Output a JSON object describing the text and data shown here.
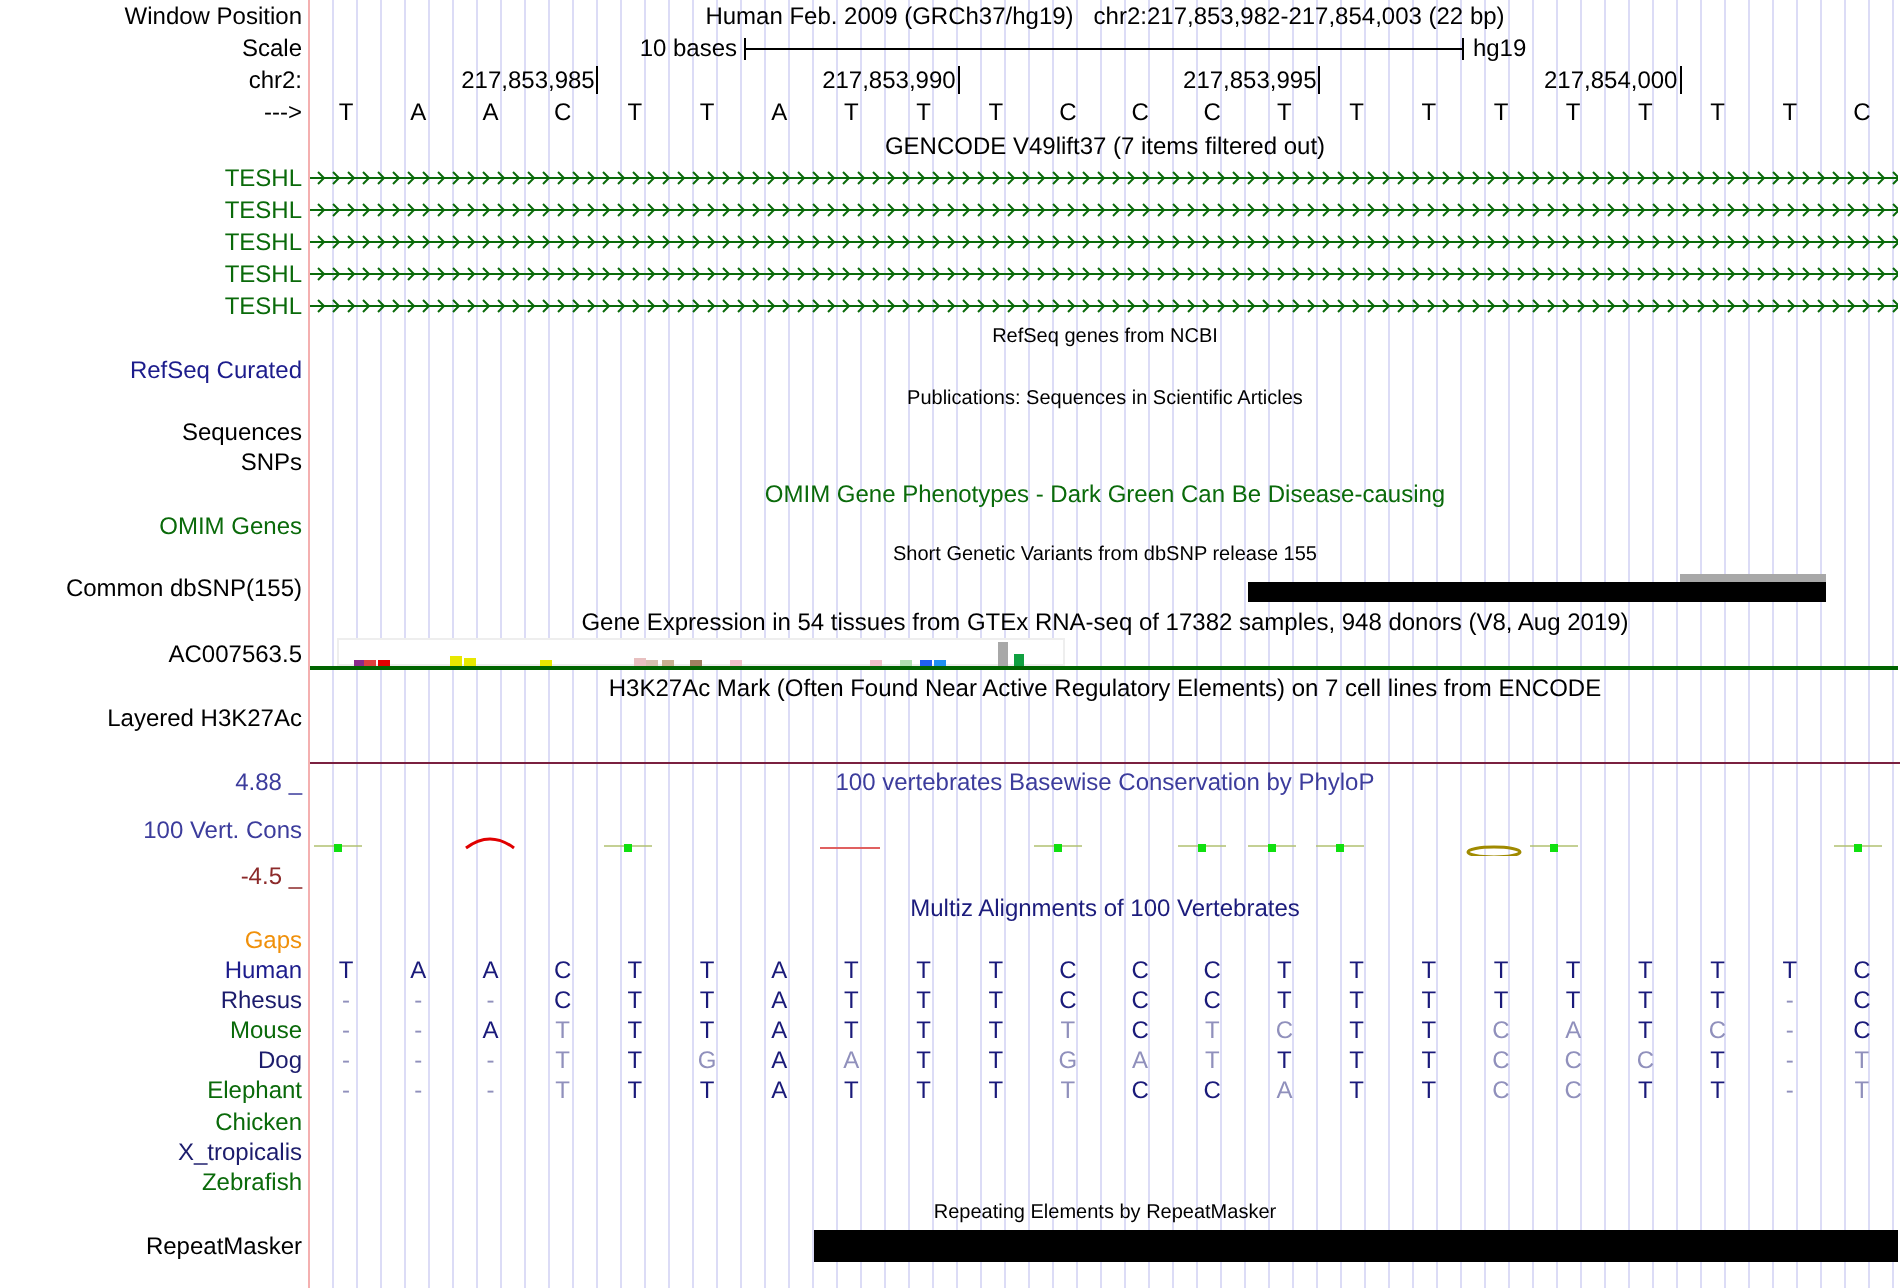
{
  "header": {
    "window_position_label": "Window Position",
    "position_title": "Human Feb. 2009 (GRCh37/hg19)   chr2:217,853,982-217,854,003 (22 bp)",
    "scale_label": "Scale",
    "scale_text": "10 bases",
    "assembly": "hg19",
    "chrom_label": "chr2:",
    "ticks": [
      "217,853,985",
      "217,853,990",
      "217,853,995",
      "217,854,000"
    ],
    "strand_label": "--->",
    "bases": [
      "T",
      "A",
      "A",
      "C",
      "T",
      "T",
      "A",
      "T",
      "T",
      "T",
      "C",
      "C",
      "C",
      "T",
      "T",
      "T",
      "T",
      "T",
      "T",
      "T",
      "T",
      "C"
    ]
  },
  "tracks": [
    {
      "kind": "title",
      "text": "GENCODE V49lift37 (7 items filtered out)",
      "color": "#000000"
    },
    {
      "kind": "gene",
      "label": "TESHL",
      "color": "#0a6a0a"
    },
    {
      "kind": "gene",
      "label": "TESHL",
      "color": "#0a6a0a"
    },
    {
      "kind": "gene",
      "label": "TESHL",
      "color": "#0a6a0a"
    },
    {
      "kind": "gene",
      "label": "TESHL",
      "color": "#0a6a0a"
    },
    {
      "kind": "gene",
      "label": "TESHL",
      "color": "#0a6a0a"
    },
    {
      "kind": "caption",
      "text": "RefSeq genes from NCBI",
      "color": "#000000"
    },
    {
      "kind": "label",
      "label": "RefSeq Curated",
      "color": "#1c1c8c"
    },
    {
      "kind": "caption",
      "text": "Publications: Sequences in Scientific Articles",
      "color": "#000000"
    },
    {
      "kind": "label",
      "label": "Sequences",
      "color": "#000000"
    },
    {
      "kind": "label",
      "label": "SNPs",
      "color": "#000000"
    },
    {
      "kind": "title",
      "text": "OMIM Gene Phenotypes - Dark Green Can Be Disease-causing",
      "color": "#0a6a0a"
    },
    {
      "kind": "label",
      "label": "OMIM Genes",
      "color": "#0a6a0a"
    },
    {
      "kind": "caption",
      "text": "Short Genetic Variants from dbSNP release 155",
      "color": "#000000"
    },
    {
      "kind": "snp",
      "label": "Common dbSNP(155)",
      "color": "#000000"
    },
    {
      "kind": "title",
      "text": "Gene Expression in 54 tissues from GTEx RNA-seq of 17382 samples, 948 donors (V8, Aug 2019)",
      "color": "#000000"
    },
    {
      "kind": "expression",
      "label": "AC007563.5",
      "color": "#000000"
    },
    {
      "kind": "title",
      "text": "H3K27Ac Mark (Often Found Near Active Regulatory Elements) on 7 cell lines from ENCODE",
      "color": "#000000"
    },
    {
      "kind": "signal",
      "label": "Layered H3K27Ac",
      "color": "#000000"
    },
    {
      "kind": "title",
      "label": "4.88 _",
      "text": "100 vertebrates Basewise Conservation by PhyloP",
      "color": "#3c3c9c"
    },
    {
      "kind": "conservation",
      "label": "100 Vert. Cons",
      "color": "#3c3c9c"
    },
    {
      "kind": "label",
      "label": "-4.5 _",
      "color": "#8c2a2a"
    },
    {
      "kind": "title",
      "text": "Multiz Alignments of 100 Vertebrates",
      "color": "#1c1c7c"
    },
    {
      "kind": "label",
      "label": "Gaps",
      "color": "#f0900a"
    },
    {
      "kind": "alignment",
      "label": "Human",
      "color": "#1c1c8c",
      "bases": [
        {
          "b": "T",
          "differs": false
        },
        {
          "b": "A",
          "differs": false
        },
        {
          "b": "A",
          "differs": false
        },
        {
          "b": "C",
          "differs": false
        },
        {
          "b": "T",
          "differs": false
        },
        {
          "b": "T",
          "differs": false
        },
        {
          "b": "A",
          "differs": false
        },
        {
          "b": "T",
          "differs": false
        },
        {
          "b": "T",
          "differs": false
        },
        {
          "b": "T",
          "differs": false
        },
        {
          "b": "C",
          "differs": false
        },
        {
          "b": "C",
          "differs": false
        },
        {
          "b": "C",
          "differs": false
        },
        {
          "b": "T",
          "differs": false
        },
        {
          "b": "T",
          "differs": false
        },
        {
          "b": "T",
          "differs": false
        },
        {
          "b": "T",
          "differs": false
        },
        {
          "b": "T",
          "differs": false
        },
        {
          "b": "T",
          "differs": false
        },
        {
          "b": "T",
          "differs": false
        },
        {
          "b": "T",
          "differs": false
        },
        {
          "b": "C",
          "differs": false
        }
      ]
    },
    {
      "kind": "alignment",
      "label": "Rhesus",
      "color": "#1c1c6c",
      "bases": [
        {
          "b": "-",
          "differs": true
        },
        {
          "b": "-",
          "differs": true
        },
        {
          "b": "-",
          "differs": true
        },
        {
          "b": "C",
          "differs": false
        },
        {
          "b": "T",
          "differs": false
        },
        {
          "b": "T",
          "differs": false
        },
        {
          "b": "A",
          "differs": false
        },
        {
          "b": "T",
          "differs": false
        },
        {
          "b": "T",
          "differs": false
        },
        {
          "b": "T",
          "differs": false
        },
        {
          "b": "C",
          "differs": false
        },
        {
          "b": "C",
          "differs": false
        },
        {
          "b": "C",
          "differs": false
        },
        {
          "b": "T",
          "differs": false
        },
        {
          "b": "T",
          "differs": false
        },
        {
          "b": "T",
          "differs": false
        },
        {
          "b": "T",
          "differs": false
        },
        {
          "b": "T",
          "differs": false
        },
        {
          "b": "T",
          "differs": false
        },
        {
          "b": "T",
          "differs": false
        },
        {
          "b": "-",
          "differs": true
        },
        {
          "b": "C",
          "differs": false
        }
      ]
    },
    {
      "kind": "alignment",
      "label": "Mouse",
      "color": "#0a6a0a",
      "bases": [
        {
          "b": "-",
          "differs": true
        },
        {
          "b": "-",
          "differs": true
        },
        {
          "b": "A",
          "differs": false
        },
        {
          "b": "T",
          "differs": true
        },
        {
          "b": "T",
          "differs": false
        },
        {
          "b": "T",
          "differs": false
        },
        {
          "b": "A",
          "differs": false
        },
        {
          "b": "T",
          "differs": false
        },
        {
          "b": "T",
          "differs": false
        },
        {
          "b": "T",
          "differs": false
        },
        {
          "b": "T",
          "differs": true
        },
        {
          "b": "C",
          "differs": false
        },
        {
          "b": "T",
          "differs": true
        },
        {
          "b": "C",
          "differs": true
        },
        {
          "b": "T",
          "differs": false
        },
        {
          "b": "T",
          "differs": false
        },
        {
          "b": "C",
          "differs": true
        },
        {
          "b": "A",
          "differs": true
        },
        {
          "b": "T",
          "differs": false
        },
        {
          "b": "C",
          "differs": true
        },
        {
          "b": "-",
          "differs": true
        },
        {
          "b": "C",
          "differs": false
        }
      ]
    },
    {
      "kind": "alignment",
      "label": "Dog",
      "color": "#1c1c6c",
      "bases": [
        {
          "b": "-",
          "differs": true
        },
        {
          "b": "-",
          "differs": true
        },
        {
          "b": "-",
          "differs": true
        },
        {
          "b": "T",
          "differs": true
        },
        {
          "b": "T",
          "differs": false
        },
        {
          "b": "G",
          "differs": true
        },
        {
          "b": "A",
          "differs": false
        },
        {
          "b": "A",
          "differs": true
        },
        {
          "b": "T",
          "differs": false
        },
        {
          "b": "T",
          "differs": false
        },
        {
          "b": "G",
          "differs": true
        },
        {
          "b": "A",
          "differs": true
        },
        {
          "b": "T",
          "differs": true
        },
        {
          "b": "T",
          "differs": false
        },
        {
          "b": "T",
          "differs": false
        },
        {
          "b": "T",
          "differs": false
        },
        {
          "b": "C",
          "differs": true
        },
        {
          "b": "C",
          "differs": true
        },
        {
          "b": "C",
          "differs": true
        },
        {
          "b": "T",
          "differs": false
        },
        {
          "b": "-",
          "differs": true
        },
        {
          "b": "T",
          "differs": true
        }
      ]
    },
    {
      "kind": "alignment",
      "label": "Elephant",
      "color": "#0a6a0a",
      "bases": [
        {
          "b": "-",
          "differs": true
        },
        {
          "b": "-",
          "differs": true
        },
        {
          "b": "-",
          "differs": true
        },
        {
          "b": "T",
          "differs": true
        },
        {
          "b": "T",
          "differs": false
        },
        {
          "b": "T",
          "differs": false
        },
        {
          "b": "A",
          "differs": false
        },
        {
          "b": "T",
          "differs": false
        },
        {
          "b": "T",
          "differs": false
        },
        {
          "b": "T",
          "differs": false
        },
        {
          "b": "T",
          "differs": true
        },
        {
          "b": "C",
          "differs": false
        },
        {
          "b": "C",
          "differs": false
        },
        {
          "b": "A",
          "differs": true
        },
        {
          "b": "T",
          "differs": false
        },
        {
          "b": "T",
          "differs": false
        },
        {
          "b": "C",
          "differs": true
        },
        {
          "b": "C",
          "differs": true
        },
        {
          "b": "T",
          "differs": false
        },
        {
          "b": "T",
          "differs": false
        },
        {
          "b": "-",
          "differs": true
        },
        {
          "b": "T",
          "differs": true
        }
      ]
    },
    {
      "kind": "alignment",
      "label": "Chicken",
      "color": "#0a6a0a"
    },
    {
      "kind": "alignment",
      "label": "X_tropicalis",
      "color": "#1c1c6c"
    },
    {
      "kind": "alignment",
      "label": "Zebrafish",
      "color": "#0a6a0a"
    },
    {
      "kind": "caption",
      "text": "Repeating Elements by RepeatMasker",
      "color": "#000000"
    },
    {
      "kind": "repeat",
      "label": "RepeatMasker",
      "color": "#000000"
    }
  ]
}
